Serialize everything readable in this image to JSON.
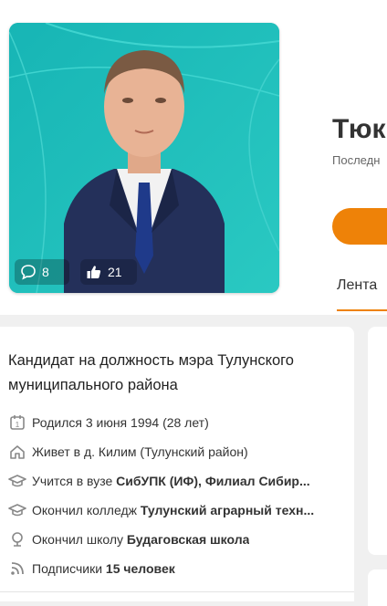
{
  "profile": {
    "name": "Тюк",
    "last_seen": "Последн",
    "comments_count": "8",
    "likes_count": "21",
    "feed_tab": "Лента"
  },
  "about": {
    "status": "Кандидат на должность мэра Тулунского муниципального района",
    "rows": [
      {
        "icon": "calendar-icon",
        "text": "Родился 3 июня 1994 (28 лет)",
        "strong": ""
      },
      {
        "icon": "home-icon",
        "text": "Живет в д. Килим (Тулунский район)",
        "strong": ""
      },
      {
        "icon": "graduation-cap-icon",
        "text": "Учится в вузе ",
        "strong": "СибУПК (ИФ), Филиал Сибир..."
      },
      {
        "icon": "graduation-cap-icon",
        "text": "Окончил колледж ",
        "strong": "Тулунский аграрный техн..."
      },
      {
        "icon": "school-icon",
        "text": "Окончил школу ",
        "strong": "Будаговская школа"
      },
      {
        "icon": "rss-icon",
        "text": "Подписчики ",
        "strong": "15 человек"
      }
    ]
  },
  "colors": {
    "accent": "#ee8208",
    "photo_bg": "#1fbdb9"
  }
}
